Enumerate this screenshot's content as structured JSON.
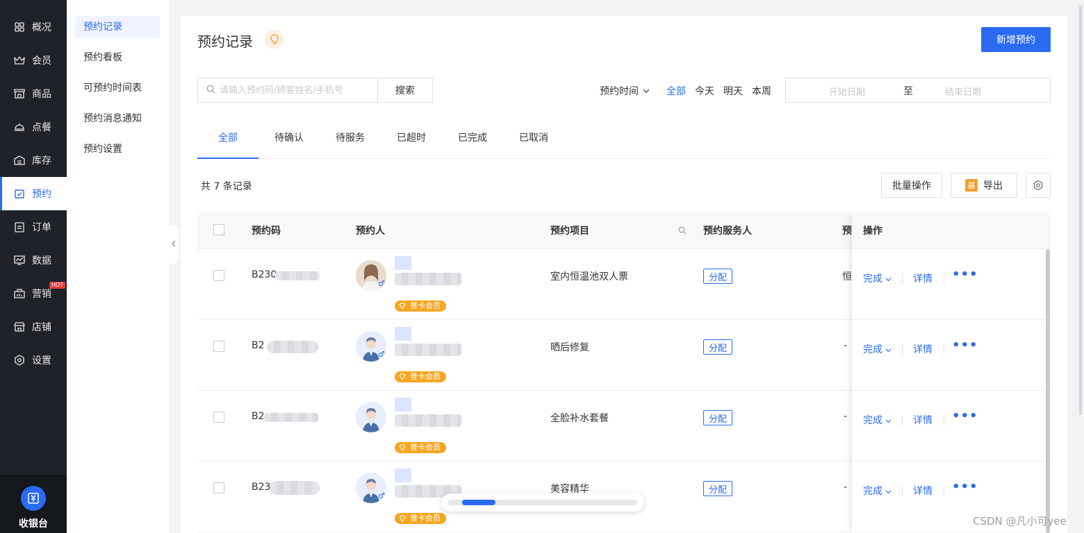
{
  "nav": {
    "items": [
      {
        "label": "概况",
        "icon": "dashboard-icon"
      },
      {
        "label": "会员",
        "icon": "crown-icon"
      },
      {
        "label": "商品",
        "icon": "store-icon"
      },
      {
        "label": "点餐",
        "icon": "cloche-icon"
      },
      {
        "label": "库存",
        "icon": "warehouse-icon"
      },
      {
        "label": "预约",
        "icon": "calendar-check-icon"
      },
      {
        "label": "订单",
        "icon": "clipboard-icon"
      },
      {
        "label": "数据",
        "icon": "chart-icon"
      },
      {
        "label": "营销",
        "icon": "marketing-icon"
      },
      {
        "label": "店铺",
        "icon": "shop-icon"
      },
      {
        "label": "设置",
        "icon": "gear-icon"
      }
    ],
    "hot_badge": "HOT",
    "cashier_label": "收银台",
    "accent": "#2a6bf2"
  },
  "submenu": {
    "items": [
      "预约记录",
      "预约看板",
      "可预约时间表",
      "预约消息通知",
      "预约设置"
    ]
  },
  "page": {
    "title": "预约记录",
    "new_button": "新增预约",
    "search_placeholder": "请输入预约码/顾客姓名/手机号",
    "search_button": "搜索",
    "time_filter_label": "预约时间",
    "quick_filters": [
      "全部",
      "今天",
      "明天",
      "本周"
    ],
    "date_start_placeholder": "开始日期",
    "date_separator": "至",
    "date_end_placeholder": "结束日期",
    "tabs": [
      "全部",
      "待确认",
      "待服务",
      "已超时",
      "已完成",
      "已取消"
    ],
    "record_count": "共 7 条记录",
    "batch_button": "批量操作",
    "export_icon_char": "基",
    "export_button": "导出"
  },
  "table": {
    "headers": [
      "预约码",
      "预约人",
      "预约项目",
      "预约服务人",
      "预",
      "操作"
    ],
    "rows": [
      {
        "code": "B230",
        "badge": "普卡会员",
        "project": "室内恒温池双人票",
        "assign": "分配",
        "extra": "恒",
        "complete": "完成",
        "detail": "详情",
        "avatar": "photo"
      },
      {
        "code": "B2",
        "badge": "普卡会员",
        "project": "晒后修复",
        "assign": "分配",
        "extra": "-",
        "complete": "完成",
        "detail": "详情",
        "avatar": "default"
      },
      {
        "code": "B2",
        "badge": "普卡会员",
        "project": "全脸补水套餐",
        "assign": "分配",
        "extra": "-",
        "complete": "完成",
        "detail": "详情",
        "avatar": "default"
      },
      {
        "code": "B23",
        "badge": "普卡会员",
        "project": "美容精华",
        "assign": "分配",
        "extra": "-",
        "complete": "完成",
        "detail": "详情",
        "avatar": "default"
      }
    ],
    "gender_symbol": "♂",
    "more_symbol": "•••"
  },
  "scroll_progress": 0.18,
  "watermark": "CSDN @凡小可yee"
}
